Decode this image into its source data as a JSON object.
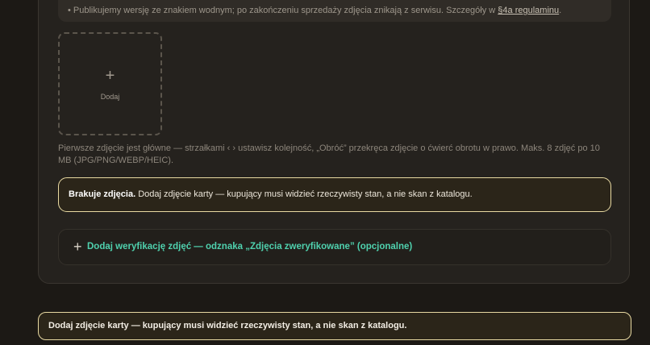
{
  "info": {
    "text": "• Publikujemy wersję ze znakiem wodnym; po zakończeniu sprzedaży zdjęcia znikają z serwisu. Szczegóły w ",
    "link": "§4a regulaminu",
    "end": "."
  },
  "add_tile": {
    "plus": "+",
    "label": "Dodaj"
  },
  "hint": "Pierwsze zdjęcie jest główne — strzałkami ‹ › ustawisz kolejność, „Obróć” przekręca zdjęcie o ćwierć obrotu w prawo. Maks. 8 zdjęć po 10 MB (JPG/PNG/WEBP/HEIC).",
  "warning": {
    "bold": "Brakuje zdjęcia.",
    "text": " Dodaj zdjęcie karty — kupujący musi widzieć rzeczywisty stan, a nie skan z katalogu."
  },
  "verification": {
    "plus": "+",
    "label": "Dodaj weryfikację zdjęć — odznaka „Zdjęcia zweryfikowane” (opcjonalne)"
  },
  "toast": "Dodaj zdjęcie karty — kupujący musi widzieć rzeczywisty stan, a nie skan z katalogu.",
  "colors": {
    "accent": "#4fd1ae",
    "warning_border": "#e8d9a2",
    "background": "#1c1915"
  }
}
